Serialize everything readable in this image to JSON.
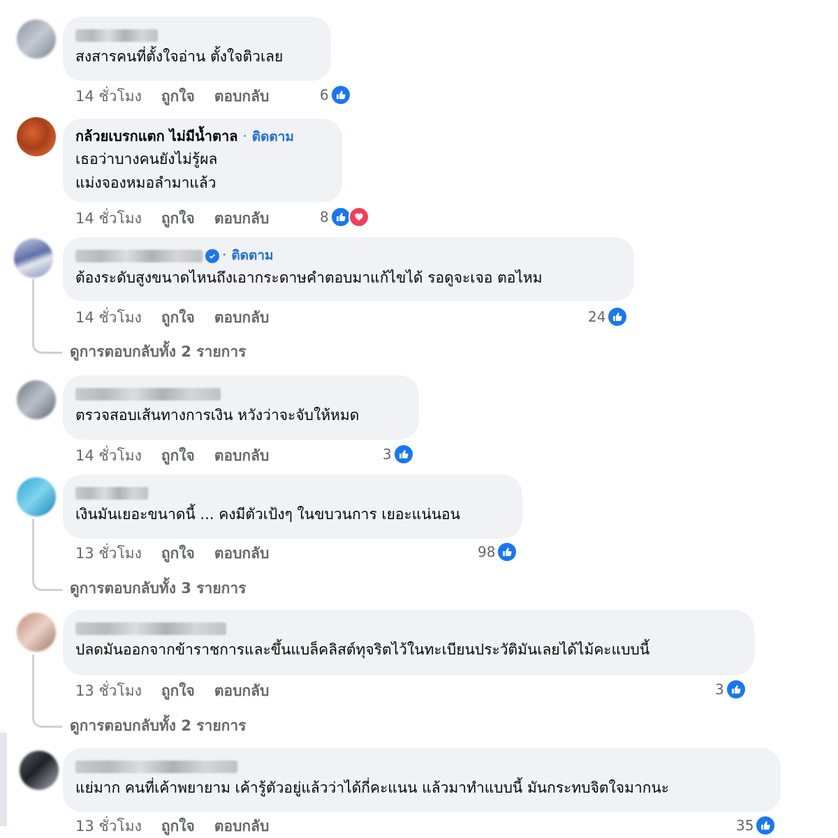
{
  "comments": [
    {
      "author": "",
      "text_lines": [
        "สงสารคนที่ตั้งใจอ่าน ตั้งใจติวเลย"
      ],
      "time": "14 ชั่วโมง",
      "like": "ถูกใจ",
      "reply": "ตอบกลับ",
      "reaction_count": "6"
    },
    {
      "author": "กล้วยเบรกแตก ไม่มีน้ำตาล",
      "follow": "ติดตาม",
      "text_lines": [
        "เธอว่าบางคนยังไม่รู้ผล",
        "แม่งจองหมอลำมาแล้ว"
      ],
      "time": "14 ชั่วโมง",
      "like": "ถูกใจ",
      "reply": "ตอบกลับ",
      "reaction_count": "8"
    },
    {
      "author": "",
      "follow": "ติดตาม",
      "text_lines": [
        "ต้องระดับสูงขนาดไหนถึงเอากระดาษคำตอบมาแก้ไขได้ รอดูจะเจอ ตอไหม"
      ],
      "time": "14 ชั่วโมง",
      "like": "ถูกใจ",
      "reply": "ตอบกลับ",
      "reaction_count": "24",
      "view_replies": "ดูการตอบกลับทั้ง 2 รายการ"
    },
    {
      "author": "",
      "text_lines": [
        "ตรวจสอบเส้นทางการเงิน หวังว่าจะจับให้หมด"
      ],
      "time": "14 ชั่วโมง",
      "like": "ถูกใจ",
      "reply": "ตอบกลับ",
      "reaction_count": "3"
    },
    {
      "author": "",
      "text_lines": [
        "เงินมันเยอะขนาดนี้ ... คงมีตัวเป้งๆ ในขบวนการ เยอะแน่นอน"
      ],
      "time": "13 ชั่วโมง",
      "like": "ถูกใจ",
      "reply": "ตอบกลับ",
      "reaction_count": "98",
      "view_replies": "ดูการตอบกลับทั้ง 3 รายการ"
    },
    {
      "author": "",
      "text_lines": [
        "ปลดมันออกจากข้าราชการและขึ้นแบล็คลิสต์ทุจริตไว้ในทะเบียนประวัติมันเลยได้ไม้คะแบบนี้"
      ],
      "time": "13 ชั่วโมง",
      "like": "ถูกใจ",
      "reply": "ตอบกลับ",
      "reaction_count": "3",
      "view_replies": "ดูการตอบกลับทั้ง 2 รายการ"
    },
    {
      "author": "",
      "text_lines": [
        "แย่มาก คนที่เค้าพยายาม เค้ารู้ตัวอยู่แล้วว่าได้กี่คะแนน แล้วมาทำแบบนี้ มันกระทบจิตใจมากนะ"
      ],
      "time": "13 ชั่วโมง",
      "like": "ถูกใจ",
      "reply": "ตอบกลับ",
      "reaction_count": "35"
    }
  ],
  "colors": {
    "bubble": "#f0f2f5",
    "link": "#216fdb",
    "meta": "#65676b",
    "like": "#1877f2",
    "love": "#f33e58"
  }
}
